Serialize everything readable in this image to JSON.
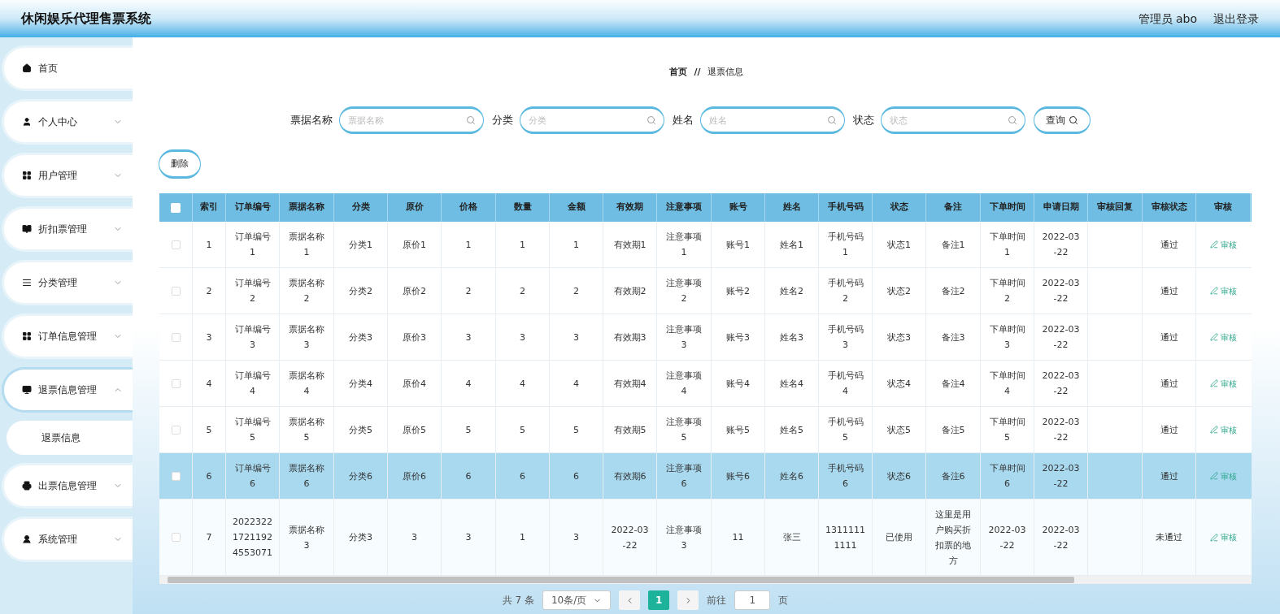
{
  "header": {
    "title": "休闲娱乐代理售票系统",
    "user": "管理员 abo",
    "logout": "退出登录"
  },
  "sidebar": {
    "items": [
      {
        "label": "首页",
        "expandable": false,
        "expanded": false
      },
      {
        "label": "个人中心",
        "expandable": true,
        "expanded": false
      },
      {
        "label": "用户管理",
        "expandable": true,
        "expanded": false
      },
      {
        "label": "折扣票管理",
        "expandable": true,
        "expanded": false
      },
      {
        "label": "分类管理",
        "expandable": true,
        "expanded": false
      },
      {
        "label": "订单信息管理",
        "expandable": true,
        "expanded": false
      },
      {
        "label": "退票信息管理",
        "expandable": true,
        "expanded": true,
        "children": [
          {
            "label": "退票信息",
            "selected": true
          }
        ]
      },
      {
        "label": "出票信息管理",
        "expandable": true,
        "expanded": false
      },
      {
        "label": "系统管理",
        "expandable": true,
        "expanded": false
      }
    ]
  },
  "breadcrumb": {
    "home": "首页",
    "separator": "//",
    "current": "退票信息"
  },
  "search": {
    "fields": [
      {
        "label": "票据名称",
        "placeholder": "票据名称"
      },
      {
        "label": "分类",
        "placeholder": "分类"
      },
      {
        "label": "姓名",
        "placeholder": "姓名"
      },
      {
        "label": "状态",
        "placeholder": "状态"
      }
    ],
    "button": "查询"
  },
  "delete_button": "删除",
  "table": {
    "all_checked": false,
    "columns": [
      "索引",
      "订单编号",
      "票据名称",
      "分类",
      "原价",
      "价格",
      "数量",
      "金额",
      "有效期",
      "注意事项",
      "账号",
      "姓名",
      "手机号码",
      "状态",
      "备注",
      "下单时间",
      "申请日期",
      "审核回复",
      "审核状态",
      "审核"
    ],
    "rows": [
      {
        "selected": false,
        "checked": false,
        "cells": [
          "1",
          "订单编号1",
          "票据名称1",
          "分类1",
          "原价1",
          "1",
          "1",
          "1",
          "有效期1",
          "注意事项1",
          "账号1",
          "姓名1",
          "手机号码1",
          "状态1",
          "备注1",
          "下单时间1",
          "2022-03-22",
          "",
          "通过"
        ],
        "action": "审核"
      },
      {
        "selected": false,
        "checked": false,
        "cells": [
          "2",
          "订单编号2",
          "票据名称2",
          "分类2",
          "原价2",
          "2",
          "2",
          "2",
          "有效期2",
          "注意事项2",
          "账号2",
          "姓名2",
          "手机号码2",
          "状态2",
          "备注2",
          "下单时间2",
          "2022-03-22",
          "",
          "通过"
        ],
        "action": "审核"
      },
      {
        "selected": false,
        "checked": false,
        "cells": [
          "3",
          "订单编号3",
          "票据名称3",
          "分类3",
          "原价3",
          "3",
          "3",
          "3",
          "有效期3",
          "注意事项3",
          "账号3",
          "姓名3",
          "手机号码3",
          "状态3",
          "备注3",
          "下单时间3",
          "2022-03-22",
          "",
          "通过"
        ],
        "action": "审核"
      },
      {
        "selected": false,
        "checked": false,
        "cells": [
          "4",
          "订单编号4",
          "票据名称4",
          "分类4",
          "原价4",
          "4",
          "4",
          "4",
          "有效期4",
          "注意事项4",
          "账号4",
          "姓名4",
          "手机号码4",
          "状态4",
          "备注4",
          "下单时间4",
          "2022-03-22",
          "",
          "通过"
        ],
        "action": "审核"
      },
      {
        "selected": false,
        "checked": false,
        "cells": [
          "5",
          "订单编号5",
          "票据名称5",
          "分类5",
          "原价5",
          "5",
          "5",
          "5",
          "有效期5",
          "注意事项5",
          "账号5",
          "姓名5",
          "手机号码5",
          "状态5",
          "备注5",
          "下单时间5",
          "2022-03-22",
          "",
          "通过"
        ],
        "action": "审核"
      },
      {
        "selected": true,
        "checked": false,
        "cells": [
          "6",
          "订单编号6",
          "票据名称6",
          "分类6",
          "原价6",
          "6",
          "6",
          "6",
          "有效期6",
          "注意事项6",
          "账号6",
          "姓名6",
          "手机号码6",
          "状态6",
          "备注6",
          "下单时间6",
          "2022-03-22",
          "",
          "通过"
        ],
        "action": "审核"
      },
      {
        "selected": false,
        "checked": false,
        "cells": [
          "7",
          "202232217211924553071",
          "票据名称3",
          "分类3",
          "3",
          "3",
          "1",
          "3",
          "2022-03-22",
          "注意事项3",
          "11",
          "张三",
          "13111111111",
          "已使用",
          "这里是用户购买折扣票的地方",
          "2022-03-22",
          "2022-03-22",
          "",
          "未通过"
        ],
        "action": "审核"
      }
    ]
  },
  "pagination": {
    "total": "共 7 条",
    "page_size": "10条/页",
    "pages": [
      {
        "label": "1",
        "selected": true
      }
    ],
    "goto_label": "前往",
    "goto_value": "1",
    "goto_suffix": "页"
  }
}
